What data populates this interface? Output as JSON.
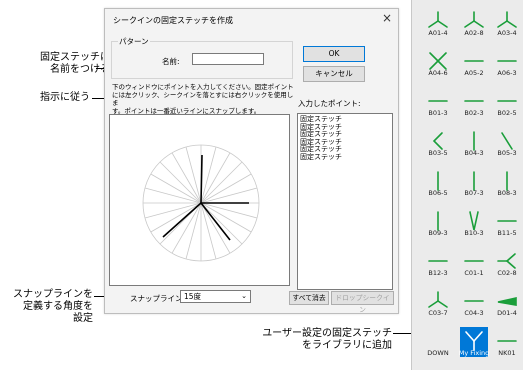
{
  "callouts": {
    "name_line1": "固定ステッチに",
    "name_line2": "名前をつける",
    "follow": "指示に従う",
    "snap_line1": "スナップラインを",
    "snap_line2": "定義する角度を",
    "snap_line3": "設定",
    "library_line1": "ユーザー設定の固定ステッチ",
    "library_line2": "をライブラリに追加"
  },
  "dialog": {
    "title": "シークインの固定ステッチを作成",
    "close_glyph": "×",
    "pattern_group": "パターン",
    "name_label": "名前:",
    "name_value": "",
    "ok": "OK",
    "cancel": "キャンセル",
    "instruction_line1": "下のウィンドウにポイントを入力してください。固定ポイント",
    "instruction_line2": "には左クリック、シークインを落とすには右クリックを使用しま",
    "instruction_line3": "す。ポイントは一番近いラインにスナップします。",
    "entered_label": "入力したポイント:",
    "entered_points": [
      "固定ステッチ",
      "固定ステッチ",
      "固定ステッチ",
      "固定ステッチ",
      "固定ステッチ",
      "固定ステッチ"
    ],
    "snap_label": "スナップライン:",
    "snap_value": "15度",
    "clear_all": "すべて消去",
    "drop_sequin": "ドロップシークイン"
  },
  "library": {
    "accent_color": "#1a9e3a",
    "selected_color": "#0078d7",
    "items": [
      {
        "label": "A01-4",
        "icon": "three-way-split-icon"
      },
      {
        "label": "A02-8",
        "icon": "three-way-split-icon"
      },
      {
        "label": "A03-4",
        "icon": "three-way-split-icon"
      },
      {
        "label": "A04-6",
        "icon": "x-cross-icon"
      },
      {
        "label": "A05-2",
        "icon": "horizontal-line-icon"
      },
      {
        "label": "A06-3",
        "icon": "horizontal-line-icon"
      },
      {
        "label": "B01-3",
        "icon": "horizontal-line-icon"
      },
      {
        "label": "B02-3",
        "icon": "horizontal-line-icon"
      },
      {
        "label": "B02-5",
        "icon": "horizontal-line-icon"
      },
      {
        "label": "B03-5",
        "icon": "chevron-left-icon"
      },
      {
        "label": "B04-3",
        "icon": "vertical-line-icon"
      },
      {
        "label": "B05-3",
        "icon": "diagonal-line-icon"
      },
      {
        "label": "B06-5",
        "icon": "vertical-line-icon"
      },
      {
        "label": "B07-3",
        "icon": "vertical-line-icon"
      },
      {
        "label": "B08-3",
        "icon": "vertical-line-icon"
      },
      {
        "label": "B09-3",
        "icon": "vertical-line-icon"
      },
      {
        "label": "B10-3",
        "icon": "v-shape-icon"
      },
      {
        "label": "B11-5",
        "icon": "horizontal-line-icon"
      },
      {
        "label": "B12-3",
        "icon": "horizontal-line-icon"
      },
      {
        "label": "C01-1",
        "icon": "horizontal-line-icon"
      },
      {
        "label": "C02-8",
        "icon": "fork-right-icon"
      },
      {
        "label": "C03-7",
        "icon": "three-way-split-icon"
      },
      {
        "label": "C04-3",
        "icon": "horizontal-line-icon"
      },
      {
        "label": "D01-4",
        "icon": "wedge-icon"
      },
      {
        "label": "DOWN",
        "icon": "none"
      },
      {
        "label": "My Fixing",
        "icon": "y-fork-icon"
      },
      {
        "label": "NK01",
        "icon": "horizontal-line-icon"
      }
    ]
  }
}
